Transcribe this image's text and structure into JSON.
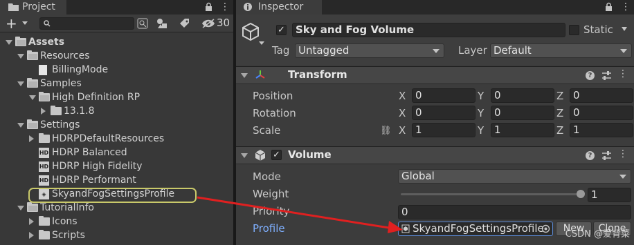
{
  "project": {
    "tab_label": "Project",
    "layers_count": "30",
    "tree": [
      {
        "label": "Assets",
        "indent": 0,
        "expand": "down",
        "icon": "folder-open",
        "bold": true
      },
      {
        "label": "Resources",
        "indent": 1,
        "expand": "down",
        "icon": "folder-open"
      },
      {
        "label": "BillingMode",
        "indent": 2,
        "expand": "none",
        "icon": "document"
      },
      {
        "label": "Samples",
        "indent": 1,
        "expand": "down",
        "icon": "folder-open"
      },
      {
        "label": "High Definition RP",
        "indent": 2,
        "expand": "down",
        "icon": "folder-open"
      },
      {
        "label": "13.1.8",
        "indent": 3,
        "expand": "right",
        "icon": "folder"
      },
      {
        "label": "Settings",
        "indent": 1,
        "expand": "down",
        "icon": "folder-open"
      },
      {
        "label": "HDRPDefaultResources",
        "indent": 2,
        "expand": "right",
        "icon": "folder"
      },
      {
        "label": "HDRP Balanced",
        "indent": 2,
        "expand": "none",
        "icon": "hd-asset"
      },
      {
        "label": "HDRP High Fidelity",
        "indent": 2,
        "expand": "none",
        "icon": "hd-asset"
      },
      {
        "label": "HDRP Performant",
        "indent": 2,
        "expand": "none",
        "icon": "hd-asset"
      },
      {
        "label": "SkyandFogSettingsProfile",
        "indent": 2,
        "expand": "none",
        "icon": "volume-profile",
        "highlighted": true
      },
      {
        "label": "TutorialInfo",
        "indent": 1,
        "expand": "down",
        "icon": "folder-open"
      },
      {
        "label": "Icons",
        "indent": 2,
        "expand": "right",
        "icon": "folder"
      },
      {
        "label": "Scripts",
        "indent": 2,
        "expand": "right",
        "icon": "folder"
      }
    ]
  },
  "inspector": {
    "tab_label": "Inspector",
    "object_name": "Sky and Fog Volume",
    "active": true,
    "static_label": "Static",
    "tag_label": "Tag",
    "tag_value": "Untagged",
    "layer_label": "Layer",
    "layer_value": "Default",
    "transform": {
      "title": "Transform",
      "rows": [
        {
          "label": "Position",
          "x": "0",
          "y": "0",
          "z": "0"
        },
        {
          "label": "Rotation",
          "x": "0",
          "y": "0",
          "z": "0"
        },
        {
          "label": "Scale",
          "x": "1",
          "y": "1",
          "z": "1"
        }
      ],
      "axis_x": "X",
      "axis_y": "Y",
      "axis_z": "Z"
    },
    "volume": {
      "title": "Volume",
      "mode_label": "Mode",
      "mode_value": "Global",
      "weight_label": "Weight",
      "weight_value": "1",
      "weight_fraction": 1.0,
      "priority_label": "Priority",
      "priority_value": "0",
      "profile_label": "Profile",
      "profile_value": "SkyandFogSettingsProfile",
      "new_label": "New",
      "clone_label": "Clone"
    }
  },
  "watermark": "CSDN @爱背菜",
  "colors": {
    "accent_link": "#7fb0ff",
    "highlight_outline": "#c9c96a",
    "arrow": "#e02020"
  }
}
